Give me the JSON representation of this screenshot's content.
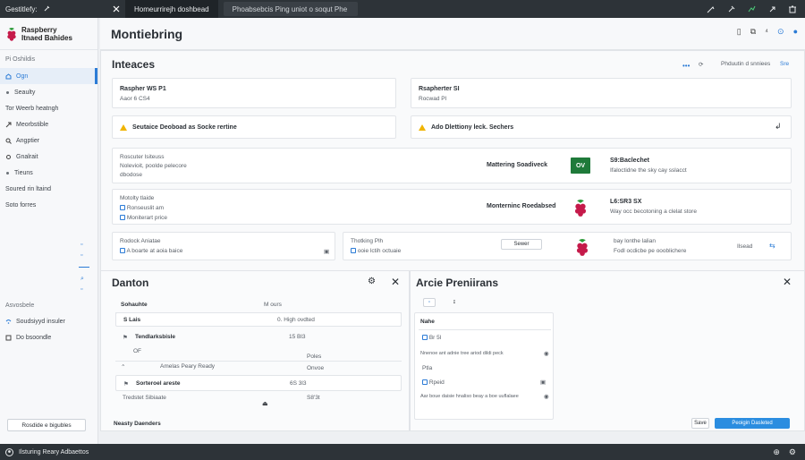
{
  "topbar": {
    "brand": "Gestitlefy:",
    "tab_active": "Homeurrirejh doshbead",
    "tab_second": "Phoabsebcis Ping uniot o soqut Phe"
  },
  "sidebar": {
    "logo_line1": "Raspberry",
    "logo_line2": "Itnaed Bahides",
    "section": "Pi Oshildis",
    "items": [
      {
        "label": "Ogn",
        "icon": "home-icon"
      },
      {
        "label": "Seaulty",
        "icon": "dot-icon"
      },
      {
        "label": "Tor Weerb heatngh",
        "icon": "dot-icon"
      },
      {
        "label": "Meorbstible",
        "icon": "arrow-icon"
      },
      {
        "label": "Angptier",
        "icon": "search-icon"
      },
      {
        "label": "Gnalrait",
        "icon": "gear-icon"
      },
      {
        "label": "Tieuns",
        "icon": "dot-icon"
      },
      {
        "label": "Soured rin ltaind",
        "icon": "dot-icon"
      },
      {
        "label": "Soto forres",
        "icon": "dot-icon"
      }
    ],
    "lower_title": "Asvosbele",
    "lower_items": [
      "Soudsiyyd insuler",
      "Do bsoondle"
    ],
    "bottom_button": "Rosdide e bigubles"
  },
  "header": {
    "title": "Montiebring"
  },
  "interfaces": {
    "title": "Inteaces",
    "right_label": "Phduutin d snniees",
    "right_link": "Sre",
    "cards": [
      {
        "title": "Raspher WS P1",
        "sub": "Aaor 6 CS4"
      },
      {
        "title": "Rsapherter SI",
        "sub": "Rocwad Pl"
      }
    ],
    "warnings": [
      "Seutaice Deoboad as Socke rertine",
      "Ado Dlettiony leck. Sechers"
    ],
    "row1": {
      "left1": "Roscuter lsiteuss",
      "left2": "Nolevioit, poolde pelecore",
      "left3": "dbodose",
      "mid": "Mattering Soadiveck",
      "badge": "OV",
      "right1": "S9:Baclechet",
      "right2": "Ifaloctidne the sky cay sslacct"
    },
    "row2": {
      "left1": "Motolty tlaide",
      "left2": "Ronseuslit am",
      "left3": "Moniterart price",
      "mid": "Monterninc Roedabsed",
      "right1": "L6:SR3 SX",
      "right2": "Way occ becotoning a clelat store"
    },
    "row3": {
      "left1": "Rodock Aniatae",
      "left2": "A boarte at aoia baice",
      "mid1": "Thotking Plh",
      "mid2": "ooie lctih octuaie",
      "button": "Sewer",
      "right1": "bay lonthe lalian",
      "right2": "Fodl ocdicbe pe oooblichere",
      "right3": "Ilsead"
    }
  },
  "danton": {
    "title": "Danton",
    "col1": "Sohauhte",
    "col2": "M ours",
    "rows": [
      {
        "name": "S Lais",
        "value": "0. High ovdted"
      },
      {
        "name": "Tendlarksbisle",
        "value": "15 Bl3"
      },
      {
        "name": "OF",
        "value": "Poles"
      },
      {
        "name": "Amelas Peary Ready",
        "value": "Onvoe"
      },
      {
        "name": "Sorteroel areste",
        "value": "6S 3l3"
      },
      {
        "name": "Tredstet Sibiaate",
        "value": "S8'3t"
      }
    ],
    "footer": "Neasty Daenders"
  },
  "arcie": {
    "title": "Arcie Preniirans",
    "col": "Nahe",
    "rows": [
      {
        "label": "Br 5l"
      },
      {
        "label": "Nnenoe ant adnie tree ariod dildi peck"
      },
      {
        "label": "Ptla"
      },
      {
        "label": "Rpeid"
      },
      {
        "label": "Aar boue daisie hnaliso beay a boe uuflalaee"
      }
    ],
    "btn_secondary": "Save",
    "btn_primary": "Peoigin Dasleted"
  },
  "bottombar": {
    "label": "Ilsturing Reary Adbaettos"
  },
  "colors": {
    "accent": "#2b7bd6",
    "warning": "#f0b400",
    "ok": "#1f7a3a",
    "raspberry": "#c51a4a"
  }
}
